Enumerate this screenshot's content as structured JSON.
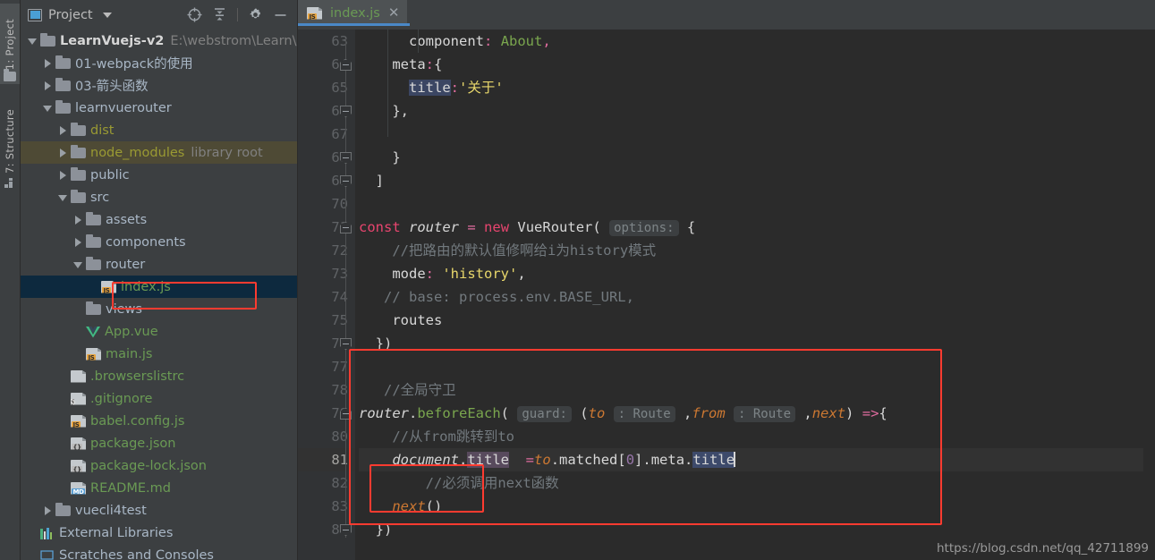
{
  "toolstrip": {
    "project_label": "1: Project",
    "structure_label": "7: Structure",
    "folder_icon": "folder-icon",
    "structure_icon": "structure-icon"
  },
  "project_panel": {
    "title": "Project",
    "dropdown_icon": "chevron-down-icon",
    "window_icon": "project-window-icon",
    "actions": [
      {
        "name": "locate-icon",
        "tooltip": "Select Opened File"
      },
      {
        "name": "collapse-all-icon",
        "tooltip": "Collapse All"
      },
      {
        "name": "gear-icon",
        "tooltip": "Settings"
      },
      {
        "name": "minimize-icon",
        "tooltip": "Hide"
      }
    ],
    "tree": [
      {
        "label": "LearnVuejs-v2",
        "suffix": "E:\\webstrom\\Learn\\",
        "indent": 0,
        "arrow": "down",
        "icon": "folder",
        "style": "bold"
      },
      {
        "label": "01-webpack的使用",
        "suffix": "",
        "indent": 1,
        "arrow": "right",
        "icon": "folder",
        "style": "plain"
      },
      {
        "label": "03-箭头函数",
        "suffix": "",
        "indent": 1,
        "arrow": "right",
        "icon": "folder",
        "style": "plain"
      },
      {
        "label": "learnvuerouter",
        "suffix": "",
        "indent": 1,
        "arrow": "down",
        "icon": "folder",
        "style": "plain"
      },
      {
        "label": "dist",
        "suffix": "",
        "indent": 2,
        "arrow": "right",
        "icon": "folder",
        "style": "olive"
      },
      {
        "label": "node_modules",
        "suffix": "library root",
        "indent": 2,
        "arrow": "right",
        "icon": "folder",
        "style": "olive",
        "row_highlight": "library"
      },
      {
        "label": "public",
        "suffix": "",
        "indent": 2,
        "arrow": "right",
        "icon": "folder",
        "style": "plain"
      },
      {
        "label": "src",
        "suffix": "",
        "indent": 2,
        "arrow": "down",
        "icon": "folder",
        "style": "plain"
      },
      {
        "label": "assets",
        "suffix": "",
        "indent": 3,
        "arrow": "right",
        "icon": "folder",
        "style": "plain"
      },
      {
        "label": "components",
        "suffix": "",
        "indent": 3,
        "arrow": "right",
        "icon": "folder",
        "style": "plain"
      },
      {
        "label": "router",
        "suffix": "",
        "indent": 3,
        "arrow": "down",
        "icon": "folder",
        "style": "plain"
      },
      {
        "label": "index.js",
        "suffix": "",
        "indent": 4,
        "arrow": "none",
        "icon": "js",
        "style": "green",
        "row_highlight": "selected",
        "annotated": true
      },
      {
        "label": "views",
        "suffix": "",
        "indent": 3,
        "arrow": "none",
        "icon": "folder",
        "style": "plain"
      },
      {
        "label": "App.vue",
        "suffix": "",
        "indent": 3,
        "arrow": "none",
        "icon": "vue",
        "style": "green"
      },
      {
        "label": "main.js",
        "suffix": "",
        "indent": 3,
        "arrow": "none",
        "icon": "js",
        "style": "green"
      },
      {
        "label": ".browserslistrc",
        "suffix": "",
        "indent": 2,
        "arrow": "none",
        "icon": "text",
        "style": "green"
      },
      {
        "label": ".gitignore",
        "suffix": "",
        "indent": 2,
        "arrow": "none",
        "icon": "ignore",
        "style": "green"
      },
      {
        "label": "babel.config.js",
        "suffix": "",
        "indent": 2,
        "arrow": "none",
        "icon": "js",
        "style": "green"
      },
      {
        "label": "package.json",
        "suffix": "",
        "indent": 2,
        "arrow": "none",
        "icon": "json",
        "style": "green"
      },
      {
        "label": "package-lock.json",
        "suffix": "",
        "indent": 2,
        "arrow": "none",
        "icon": "json",
        "style": "green"
      },
      {
        "label": "README.md",
        "suffix": "",
        "indent": 2,
        "arrow": "none",
        "icon": "md",
        "style": "green"
      },
      {
        "label": "vuecli4test",
        "suffix": "",
        "indent": 1,
        "arrow": "right",
        "icon": "folder",
        "style": "plain"
      },
      {
        "label": "External Libraries",
        "suffix": "",
        "indent": 0,
        "arrow": "none",
        "icon": "extlib",
        "style": "plain"
      },
      {
        "label": "Scratches and Consoles",
        "suffix": "",
        "indent": 0,
        "arrow": "none",
        "icon": "scratch",
        "style": "plain"
      }
    ]
  },
  "editor": {
    "tab": {
      "label": "index.js",
      "close_icon": "close-icon",
      "file_icon": "js-file-icon"
    },
    "current_line": 81,
    "lines": [
      {
        "n": 63,
        "fold": "none"
      },
      {
        "n": 64,
        "fold": "top"
      },
      {
        "n": 65,
        "fold": "none"
      },
      {
        "n": 66,
        "fold": "bot"
      },
      {
        "n": 67,
        "fold": "none"
      },
      {
        "n": 68,
        "fold": "bot"
      },
      {
        "n": 69,
        "fold": "bot"
      },
      {
        "n": 70,
        "fold": "none"
      },
      {
        "n": 71,
        "fold": "top"
      },
      {
        "n": 72,
        "fold": "none"
      },
      {
        "n": 73,
        "fold": "none"
      },
      {
        "n": 74,
        "fold": "none"
      },
      {
        "n": 75,
        "fold": "none"
      },
      {
        "n": 76,
        "fold": "bot"
      },
      {
        "n": 77,
        "fold": "none"
      },
      {
        "n": 78,
        "fold": "none"
      },
      {
        "n": 79,
        "fold": "top"
      },
      {
        "n": 80,
        "fold": "none"
      },
      {
        "n": 81,
        "fold": "none"
      },
      {
        "n": 82,
        "fold": "none"
      },
      {
        "n": 83,
        "fold": "none"
      },
      {
        "n": 84,
        "fold": "bot"
      }
    ],
    "code_text": {
      "l63": "      component: About,",
      "l64": "    meta:{",
      "l65": "      title:'关于'",
      "l66": "    },",
      "l67": "",
      "l68": "    }",
      "l69": "  ]",
      "l70": "",
      "l71": "const router = new VueRouter( options: {",
      "l72": "    //把路由的默认值修啊给i为history模式",
      "l73": "    mode: 'history',",
      "l74": "   // base: process.env.BASE_URL,",
      "l75": "    routes",
      "l76": "  })",
      "l77": "",
      "l78": "   //全局守卫",
      "l79": "router.beforeEach( guard: (to : Route ,from : Route ,next) =>{",
      "l80": "    //从from跳转到to",
      "l81": "    document.title  =to.matched[0].meta.title",
      "l82": "        //必须调用next函数",
      "l83": "    next()",
      "l84": "  })"
    },
    "inlay_hints": {
      "options": "options:",
      "guard": "guard:",
      "route1": ": Route",
      "route2": ": Route"
    }
  },
  "annotations": {
    "box_index_js": "red-highlight-box-index-js",
    "box_global_guard": "red-highlight-box-global-guard",
    "box_next_call": "red-highlight-box-next-call"
  },
  "watermark": {
    "text": "https://blog.csdn.net/qq_42711899"
  },
  "colors": {
    "accent": "#4a88c7",
    "annotation_red": "#ff3b30",
    "selection_blue": "#0d293e",
    "library_highlight": "#4e4a35",
    "panel_bg": "#3c3f41",
    "editor_bg": "#2b2b2b",
    "gutter_bg": "#313335",
    "string": "#e8d76b",
    "keyword": "#cc7832",
    "comment": "#72797e",
    "file_green": "#6a9a54"
  }
}
